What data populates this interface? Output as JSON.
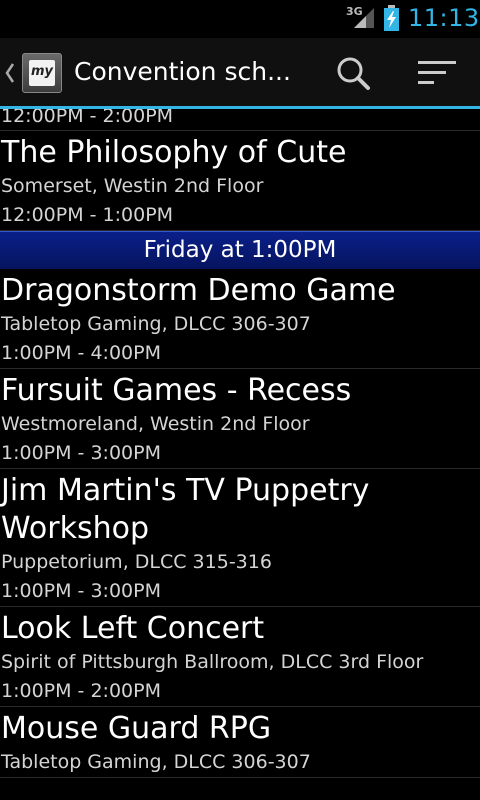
{
  "status_bar": {
    "network": "3G",
    "time": "11:13",
    "accent_color": "#33b5e5"
  },
  "action_bar": {
    "title": "Convention sch...",
    "app_icon_text": "my",
    "icons": {
      "up": "chevron-left-icon",
      "search": "search-icon",
      "sort": "sort-icon"
    }
  },
  "schedule": {
    "partial_item_time": "12:00PM - 2:00PM",
    "items_before": [
      {
        "title": "The Philosophy of Cute",
        "location": "Somerset, Westin 2nd Floor",
        "time": "12:00PM - 1:00PM"
      }
    ],
    "section_header": "Friday at 1:00PM",
    "items_after": [
      {
        "title": "Dragonstorm Demo Game",
        "location": "Tabletop Gaming, DLCC 306-307",
        "time": "1:00PM - 4:00PM"
      },
      {
        "title": "Fursuit Games - Recess",
        "location": "Westmoreland, Westin 2nd Floor",
        "time": "1:00PM - 3:00PM"
      },
      {
        "title": "Jim Martin's TV Puppetry\nWorkshop",
        "location": "Puppetorium, DLCC 315-316",
        "time": "1:00PM - 3:00PM"
      },
      {
        "title": "Look Left Concert",
        "location": "Spirit of Pittsburgh Ballroom, DLCC 3rd Floor",
        "time": "1:00PM - 2:00PM"
      },
      {
        "title": "Mouse Guard RPG",
        "location": "Tabletop Gaming, DLCC 306-307",
        "time": ""
      }
    ]
  }
}
